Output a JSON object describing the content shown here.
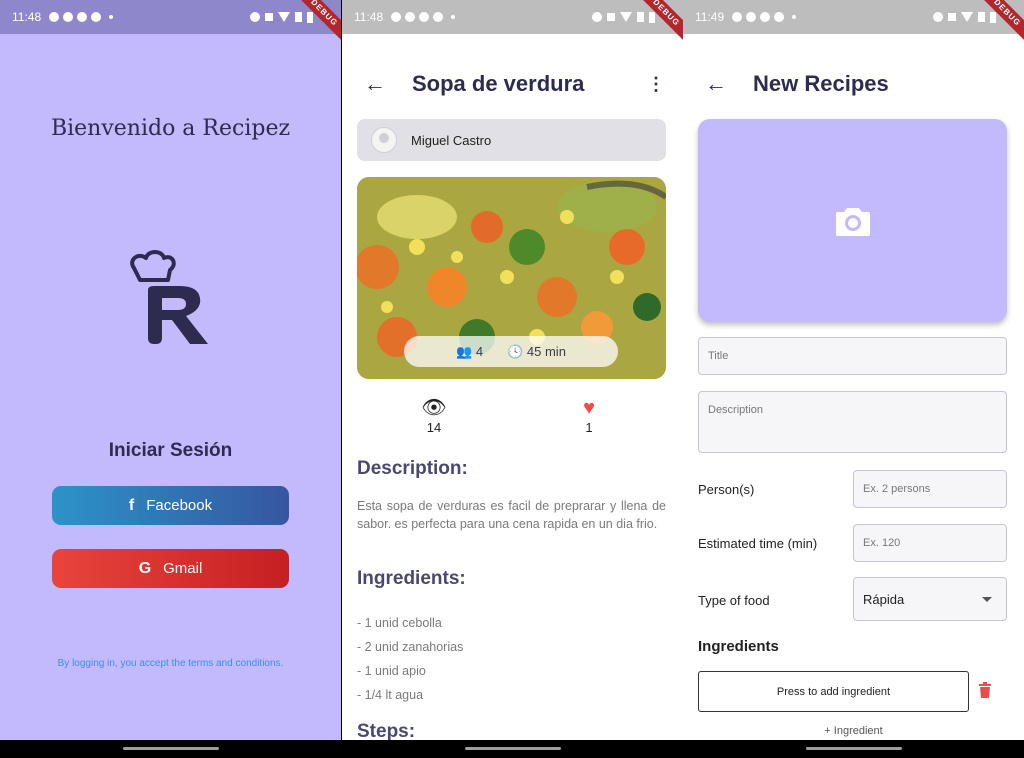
{
  "screens": {
    "login": {
      "status": {
        "time": "11:48"
      },
      "debug_label": "DEBUG",
      "welcome": "Bienvenido a Recipez",
      "login_title": "Iniciar Sesión",
      "facebook_label": "Facebook",
      "facebook_icon": "f",
      "gmail_label": "Gmail",
      "gmail_icon": "G",
      "terms": "By logging in, you accept the terms and conditions."
    },
    "detail": {
      "status": {
        "time": "11:48"
      },
      "debug_label": "DEBUG",
      "back_icon": "←",
      "title": "Sopa de verdura",
      "more_icon": "⋮",
      "author": "Miguel Castro",
      "persons": "4",
      "time": "45 min",
      "views": "14",
      "likes": "1",
      "description_heading": "Description:",
      "description": "Esta sopa de verduras es facil de preprarar y llena de sabor. es perfecta para una cena rapida en un dia frio.",
      "ingredients_heading": "Ingredients:",
      "ingredients": [
        "- 1 unid cebolla",
        "- 2 unid zanahorias",
        "- 1 unid apio",
        "- 1/4 lt agua"
      ],
      "steps_heading": "Steps:"
    },
    "new_recipe": {
      "status": {
        "time": "11:49"
      },
      "debug_label": "DEBUG",
      "back_icon": "←",
      "title": "New Recipes",
      "title_placeholder": "Title",
      "description_placeholder": "Description",
      "persons_label": "Person(s)",
      "persons_placeholder": "Ex. 2 persons",
      "time_label": "Estimated time (min)",
      "time_placeholder": "Ex. 120",
      "food_label": "Type of food",
      "food_value": "Rápida",
      "ingredients_title": "Ingredients",
      "add_ingredient": "Press to add ingredient",
      "plus_ingredient": "+ Ingredient"
    }
  },
  "colors": {
    "lavender": "#c3b9fd",
    "navy": "#2d2c4e",
    "heart": "#ef4b48",
    "trash": "#e84c4c"
  }
}
